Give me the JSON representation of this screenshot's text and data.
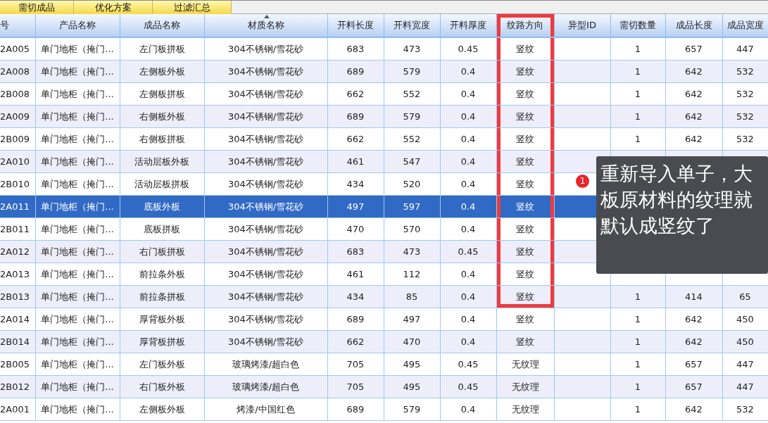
{
  "tabs": [
    {
      "label": "需切成品"
    },
    {
      "label": "优化方案"
    },
    {
      "label": "过滤汇总"
    }
  ],
  "table": {
    "columns": [
      {
        "label": "号",
        "marked": false,
        "sorted": false
      },
      {
        "label": "产品名称",
        "marked": false,
        "sorted": false
      },
      {
        "label": "成品名称",
        "marked": false,
        "sorted": false
      },
      {
        "label": "材质名称",
        "marked": false,
        "sorted": true
      },
      {
        "label": "开料长度",
        "marked": false,
        "sorted": false
      },
      {
        "label": "开料宽度",
        "marked": false,
        "sorted": false
      },
      {
        "label": "开料厚度",
        "marked": false,
        "sorted": false
      },
      {
        "label": "纹路方向",
        "marked": true,
        "sorted": false
      },
      {
        "label": "异型ID",
        "marked": false,
        "sorted": false
      },
      {
        "label": "需切数量",
        "marked": false,
        "sorted": false
      },
      {
        "label": "成品长度",
        "marked": false,
        "sorted": false
      },
      {
        "label": "成品宽度",
        "marked": false,
        "sorted": false
      }
    ],
    "rows": [
      {
        "selected": false,
        "marked": true,
        "cells": [
          "2A005",
          "单门地柜（掩门...",
          "左门板拼板",
          "304不锈钢/雪花砂",
          "683",
          "473",
          "0.45",
          "竖纹",
          null,
          "1",
          "657",
          "447"
        ]
      },
      {
        "selected": false,
        "marked": true,
        "cells": [
          "2A008",
          "单门地柜（掩门...",
          "左侧板外板",
          "304不锈钢/雪花砂",
          "689",
          "579",
          "0.4",
          "竖纹",
          null,
          "1",
          "642",
          "532"
        ]
      },
      {
        "selected": false,
        "marked": true,
        "cells": [
          "2B008",
          "单门地柜（掩门...",
          "左侧板拼板",
          "304不锈钢/雪花砂",
          "662",
          "552",
          "0.4",
          "竖纹",
          null,
          "1",
          "642",
          "532"
        ]
      },
      {
        "selected": false,
        "marked": true,
        "cells": [
          "2A009",
          "单门地柜（掩门...",
          "右侧板外板",
          "304不锈钢/雪花砂",
          "689",
          "579",
          "0.4",
          "竖纹",
          null,
          "1",
          "642",
          "532"
        ]
      },
      {
        "selected": false,
        "marked": true,
        "cells": [
          "2B009",
          "单门地柜（掩门...",
          "右侧板拼板",
          "304不锈钢/雪花砂",
          "662",
          "552",
          "0.4",
          "竖纹",
          null,
          "1",
          "642",
          "532"
        ]
      },
      {
        "selected": false,
        "marked": true,
        "cells": [
          "2A010",
          "单门地柜（掩门...",
          "活动层板外板",
          "304不锈钢/雪花砂",
          "461",
          "547",
          "0.4",
          "竖纹",
          null,
          null,
          null,
          null
        ]
      },
      {
        "selected": false,
        "marked": true,
        "cells": [
          "2B010",
          "单门地柜（掩门...",
          "活动层板拼板",
          "304不锈钢/雪花砂",
          "434",
          "520",
          "0.4",
          "竖纹",
          null,
          null,
          null,
          null
        ]
      },
      {
        "selected": true,
        "marked": true,
        "cells": [
          "2A011",
          "单门地柜（掩门...",
          "底板外板",
          "304不锈钢/雪花砂",
          "497",
          "597",
          "0.4",
          "竖纹",
          null,
          null,
          null,
          null
        ]
      },
      {
        "selected": false,
        "marked": true,
        "cells": [
          "2B011",
          "单门地柜（掩门...",
          "底板拼板",
          "304不锈钢/雪花砂",
          "470",
          "570",
          "0.4",
          "竖纹",
          null,
          null,
          null,
          null
        ]
      },
      {
        "selected": false,
        "marked": true,
        "cells": [
          "2A012",
          "单门地柜（掩门...",
          "右门板拼板",
          "304不锈钢/雪花砂",
          "683",
          "473",
          "0.45",
          "竖纹",
          null,
          null,
          null,
          null
        ]
      },
      {
        "selected": false,
        "marked": true,
        "cells": [
          "2A013",
          "单门地柜（掩门...",
          "前拉条外板",
          "304不锈钢/雪花砂",
          "461",
          "112",
          "0.4",
          "竖纹",
          null,
          null,
          null,
          null
        ]
      },
      {
        "selected": false,
        "marked": true,
        "cells": [
          "2B013",
          "单门地柜（掩门...",
          "前拉条拼板",
          "304不锈钢/雪花砂",
          "434",
          "85",
          "0.4",
          "竖纹",
          null,
          "1",
          "414",
          "65"
        ]
      },
      {
        "selected": false,
        "marked": false,
        "cells": [
          "2A014",
          "单门地柜（掩门...",
          "厚背板外板",
          "304不锈钢/雪花砂",
          "689",
          "497",
          "0.4",
          "竖纹",
          null,
          "1",
          "642",
          "450"
        ]
      },
      {
        "selected": false,
        "marked": false,
        "cells": [
          "2B014",
          "单门地柜（掩门...",
          "厚背板拼板",
          "304不锈钢/雪花砂",
          "662",
          "470",
          "0.4",
          "竖纹",
          null,
          "1",
          "642",
          "450"
        ]
      },
      {
        "selected": false,
        "marked": false,
        "cells": [
          "2B005",
          "单门地柜（掩门...",
          "左门板外板",
          "玻璃烤漆/超白色",
          "705",
          "495",
          "0.45",
          "无纹理",
          null,
          "1",
          "657",
          "447"
        ]
      },
      {
        "selected": false,
        "marked": false,
        "cells": [
          "2B012",
          "单门地柜（掩门...",
          "右门板外板",
          "玻璃烤漆/超白色",
          "705",
          "495",
          "0.45",
          "无纹理",
          null,
          "1",
          "657",
          "447"
        ]
      },
      {
        "selected": false,
        "marked": false,
        "cells": [
          "2A001",
          "单门地柜（掩门...",
          "左侧板外板",
          "烤漆/中国红色",
          "689",
          "579",
          "0.4",
          "无纹理",
          null,
          "1",
          "642",
          "532"
        ]
      }
    ]
  },
  "callout": {
    "badge": "1",
    "text": "重新导入单子，大板原材料的纹理就默认成竖纹了"
  }
}
